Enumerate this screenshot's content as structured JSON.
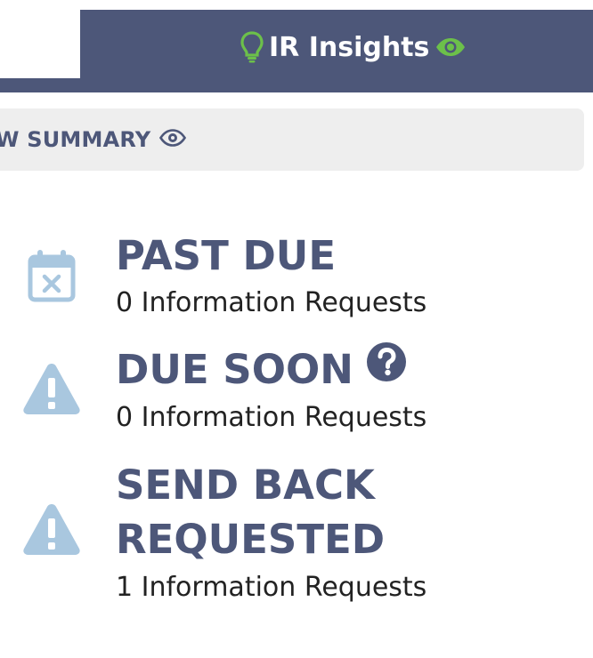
{
  "header": {
    "insights_label": "IR Insights",
    "icons": {
      "lightbulb": "lightbulb-icon",
      "eye": "eye-icon"
    },
    "colors": {
      "bar": "#4d5779",
      "accent_green": "#6cc04a"
    }
  },
  "summary": {
    "label": "W SUMMARY",
    "icon": "eye-icon"
  },
  "statuses": [
    {
      "title": "PAST DUE",
      "count_text": "0 Information Requests",
      "icon": "calendar-x-icon"
    },
    {
      "title": "DUE SOON",
      "count_text": "0 Information Requests",
      "icon": "warning-icon",
      "help_icon": "question-circle-icon"
    },
    {
      "title_line1": "SEND BACK",
      "title_line2": "REQUESTED",
      "count_text": "1 Information Requests",
      "icon": "warning-icon"
    }
  ],
  "colors": {
    "title": "#4d5779",
    "icon_light_blue": "#a9c7df",
    "strip_bg": "#eeeeee"
  }
}
